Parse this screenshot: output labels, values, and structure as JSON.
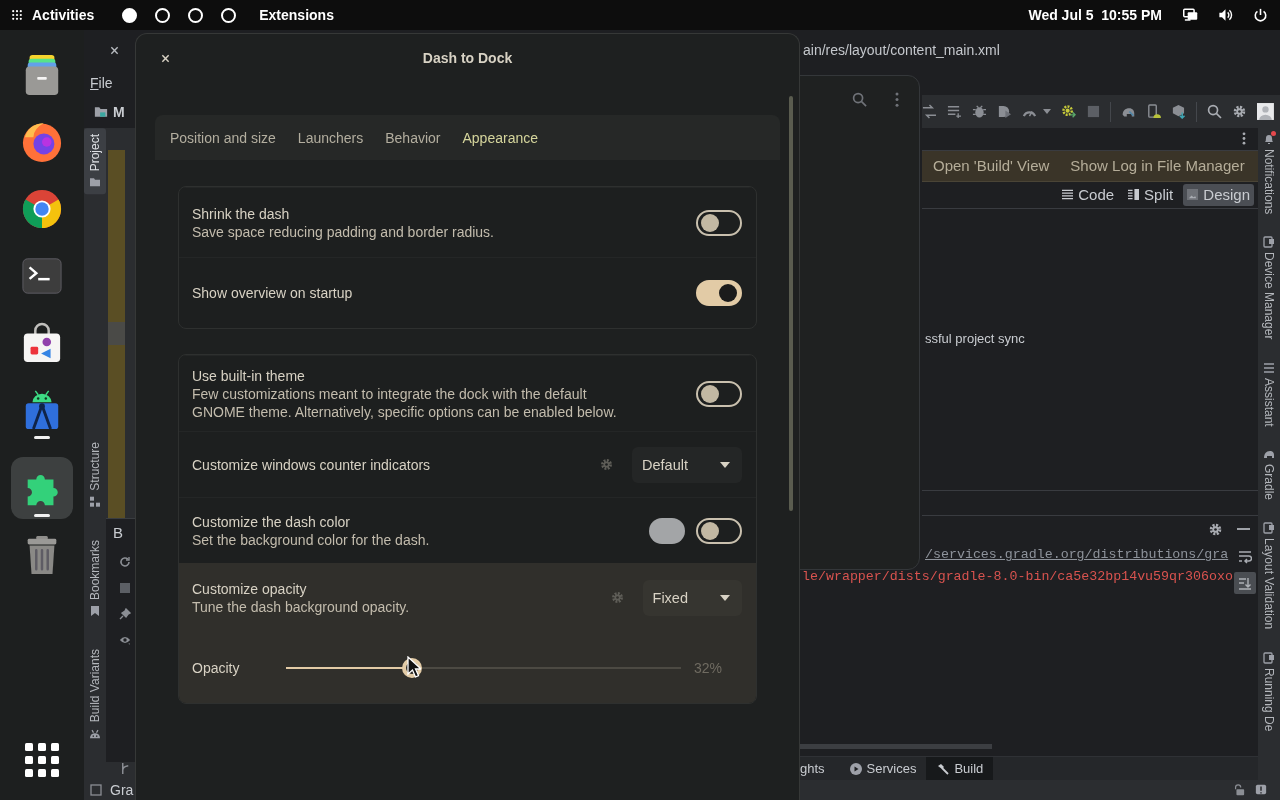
{
  "top_bar": {
    "activities": "Activities",
    "workspaces": [
      {
        "selected": true
      },
      {
        "selected": false
      },
      {
        "selected": false
      },
      {
        "selected": false
      }
    ],
    "app_menu": "Extensions",
    "clock": "Wed Jul 5  10:55 PM"
  },
  "dock": {
    "apps": [
      {
        "kind": "files",
        "running": false,
        "selected": false
      },
      {
        "kind": "firefox",
        "running": false,
        "selected": false
      },
      {
        "kind": "chrome",
        "running": false,
        "selected": false
      },
      {
        "kind": "terminal",
        "running": false,
        "selected": false
      },
      {
        "kind": "software",
        "running": false,
        "selected": false
      },
      {
        "kind": "android-studio",
        "running": true,
        "selected": false
      },
      {
        "kind": "extensions",
        "running": true,
        "selected": true
      },
      {
        "kind": "trash",
        "running": false,
        "selected": false
      }
    ]
  },
  "ide": {
    "title": "ain/res/layout/content_main.xml",
    "menu": [
      "File"
    ],
    "project": "M",
    "left_tools": [
      {
        "kind": "folder",
        "label": "Project",
        "selected": true
      },
      {
        "kind": "structure",
        "label": "Structure",
        "selected": false
      },
      {
        "kind": "bookmark",
        "label": "Bookmarks",
        "selected": false
      },
      {
        "kind": "android",
        "label": "Build Variants",
        "selected": false
      }
    ],
    "build_panel_title": "B",
    "actions": [
      "Open 'Build' View",
      "Show Log in File Manager"
    ],
    "view_modes": [
      {
        "kind": "code",
        "label": "Code",
        "selected": false
      },
      {
        "kind": "split",
        "label": "Split",
        "selected": false
      },
      {
        "kind": "design",
        "label": "Design",
        "selected": true
      }
    ],
    "message": "ssful project sync",
    "console": [
      {
        "kind": "link",
        "text": "/services.gradle.org/distributions/gra"
      },
      {
        "kind": "error",
        "text": "le/wrapper/dists/gradle-8.0-bin/ca5e32bp14vu59qr306oxo"
      }
    ],
    "bottom_tabs": [
      {
        "kind": "plain",
        "label": "ghts",
        "selected": false
      },
      {
        "kind": "services",
        "label": "Services",
        "selected": false
      },
      {
        "kind": "build",
        "label": "Build",
        "selected": true
      }
    ],
    "right_tools": [
      {
        "kind": "bell",
        "label": "Notifications",
        "alert": true
      },
      {
        "kind": "device",
        "label": "Device Manager",
        "alert": false
      },
      {
        "kind": "assistant",
        "label": "Assistant",
        "alert": false
      },
      {
        "kind": "gradle",
        "label": "Gradle",
        "alert": false
      },
      {
        "kind": "validation",
        "label": "Layout Validation",
        "alert": false
      },
      {
        "kind": "running",
        "label": "Running De",
        "alert": false
      }
    ],
    "status": "Gra"
  },
  "dialog": {
    "title": "Dash to Dock",
    "tabs": [
      {
        "label": "Position and size",
        "selected": false
      },
      {
        "label": "Launchers",
        "selected": false
      },
      {
        "label": "Behavior",
        "selected": false
      },
      {
        "label": "Appearance",
        "selected": true
      }
    ],
    "groups": [
      {
        "rows": [
          {
            "kind": "switch",
            "title": "Shrink the dash",
            "subtitle": "Save space reducing padding and border radius.",
            "on": false,
            "highlighted": false
          },
          {
            "kind": "switch",
            "title": "Show overview on startup",
            "on": true,
            "highlighted": false
          }
        ]
      },
      {
        "rows": [
          {
            "kind": "switch",
            "title": "Use built-in theme",
            "subtitle": "Few customizations meant to integrate the dock with the default GNOME theme. Alternatively, specific options can be enabled below.",
            "on": false,
            "highlighted": false
          },
          {
            "kind": "dropdown",
            "title": "Customize windows counter indicators",
            "value": "Default",
            "highlighted": false
          },
          {
            "kind": "color-switch",
            "title": "Customize the dash color",
            "subtitle": "Set the background color for the dash.",
            "color": "#a3a5a7",
            "on": false,
            "highlighted": false
          },
          {
            "kind": "dropdown",
            "title": "Customize opacity",
            "subtitle": "Tune the dash background opacity.",
            "value": "Fixed",
            "highlighted": true
          },
          {
            "kind": "slider",
            "title": "Opacity",
            "level": 0.32,
            "reading": "32%",
            "highlighted": true
          }
        ]
      }
    ]
  }
}
